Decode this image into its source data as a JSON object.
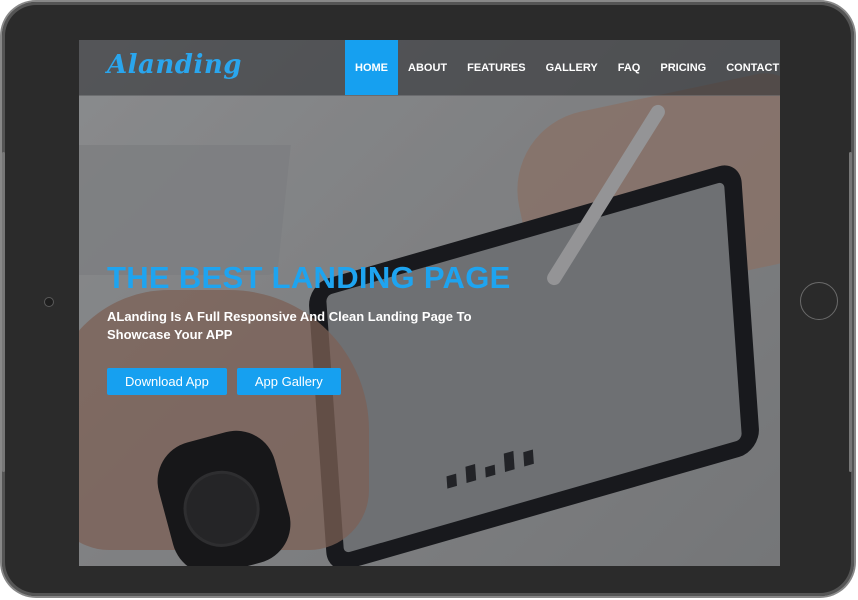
{
  "site": {
    "logo": "Alanding",
    "nav": [
      {
        "label": "HOME",
        "active": true
      },
      {
        "label": "ABOUT",
        "active": false
      },
      {
        "label": "FEATURES",
        "active": false
      },
      {
        "label": "GALLERY",
        "active": false
      },
      {
        "label": "FAQ",
        "active": false
      },
      {
        "label": "PRICING",
        "active": false
      },
      {
        "label": "CONTACT",
        "active": false
      }
    ]
  },
  "hero": {
    "title": "THE BEST LANDING PAGE",
    "subtitle": "ALanding Is A Full Responsive And Clean Landing Page To Showcase Your APP",
    "buttons": [
      {
        "label": "Download App"
      },
      {
        "label": "App Gallery"
      }
    ]
  },
  "colors": {
    "accent": "#16a0f0",
    "frame": "#2b2b2b"
  }
}
